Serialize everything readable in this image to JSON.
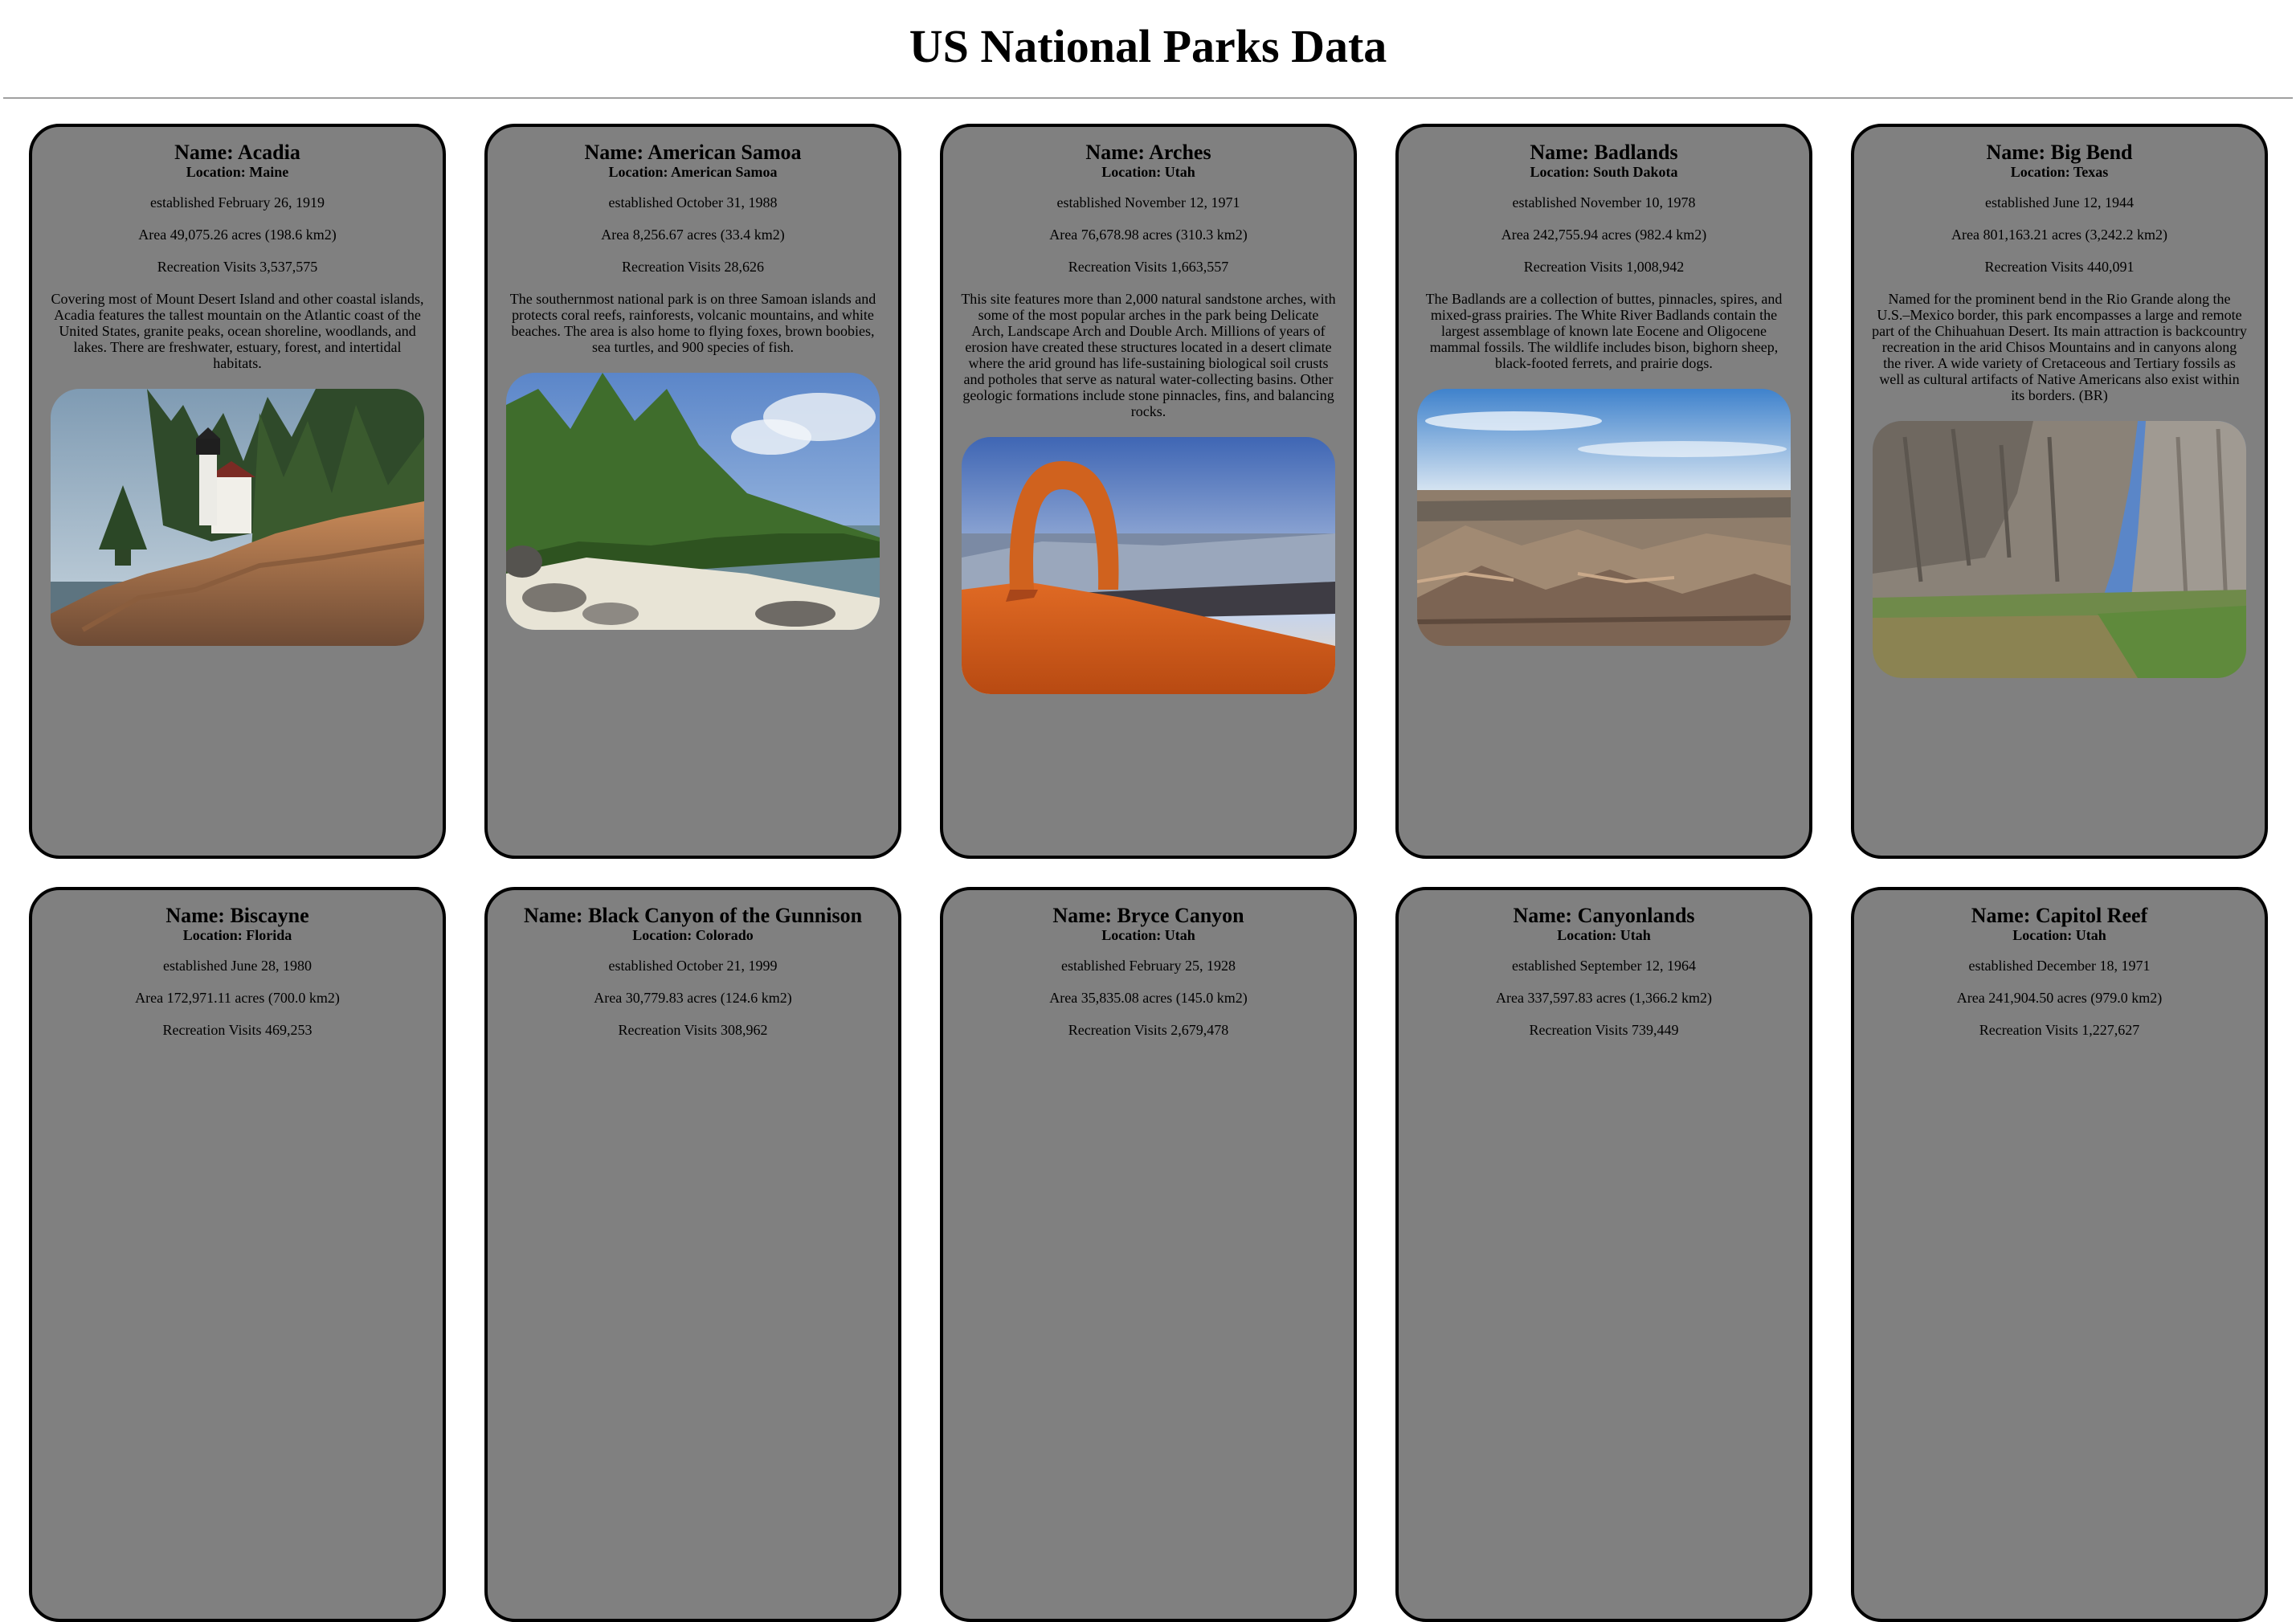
{
  "page": {
    "title": "US National Parks Data"
  },
  "parks": [
    {
      "name": "Name: Acadia",
      "location": "Location: Maine",
      "established": "established February 26, 1919",
      "area": "Area 49,075.26 acres (198.6 km2)",
      "visits": "Recreation Visits 3,537,575",
      "description": "Covering most of Mount Desert Island and other coastal islands, Acadia features the tallest mountain on the Atlantic coast of the United States, granite peaks, ocean shoreline, woodlands, and lakes. There are freshwater, estuary, forest, and intertidal habitats."
    },
    {
      "name": "Name: American Samoa",
      "location": "Location: American Samoa",
      "established": "established October 31, 1988",
      "area": "Area 8,256.67 acres (33.4 km2)",
      "visits": "Recreation Visits 28,626",
      "description": "The southernmost national park is on three Samoan islands and protects coral reefs, rainforests, volcanic mountains, and white beaches. The area is also home to flying foxes, brown boobies, sea turtles, and 900 species of fish."
    },
    {
      "name": "Name: Arches",
      "location": "Location: Utah",
      "established": "established November 12, 1971",
      "area": "Area 76,678.98 acres (310.3 km2)",
      "visits": "Recreation Visits 1,663,557",
      "description": "This site features more than 2,000 natural sandstone arches, with some of the most popular arches in the park being Delicate Arch, Landscape Arch and Double Arch. Millions of years of erosion have created these structures located in a desert climate where the arid ground has life-sustaining biological soil crusts and potholes that serve as natural water-collecting basins. Other geologic formations include stone pinnacles, fins, and balancing rocks."
    },
    {
      "name": "Name: Badlands",
      "location": "Location: South Dakota",
      "established": "established November 10, 1978",
      "area": "Area 242,755.94 acres (982.4 km2)",
      "visits": "Recreation Visits 1,008,942",
      "description": "The Badlands are a collection of buttes, pinnacles, spires, and mixed-grass prairies. The White River Badlands contain the largest assemblage of known late Eocene and Oligocene mammal fossils. The wildlife includes bison, bighorn sheep, black-footed ferrets, and prairie dogs."
    },
    {
      "name": "Name: Big Bend",
      "location": "Location: Texas",
      "established": "established June 12, 1944",
      "area": "Area 801,163.21 acres (3,242.2 km2)",
      "visits": "Recreation Visits 440,091",
      "description": "Named for the prominent bend in the Rio Grande along the U.S.–Mexico border, this park encompasses a large and remote part of the Chihuahuan Desert. Its main attraction is backcountry recreation in the arid Chisos Mountains and in canyons along the river. A wide variety of Cretaceous and Tertiary fossils as well as cultural artifacts of Native Americans also exist within its borders. (BR)"
    },
    {
      "name": "Name: Biscayne",
      "location": "Location: Florida",
      "established": "established June 28, 1980",
      "area": "Area 172,971.11 acres (700.0 km2)",
      "visits": "Recreation Visits 469,253",
      "description": ""
    },
    {
      "name": "Name: Black Canyon of the Gunnison",
      "location": "Location: Colorado",
      "established": "established October 21, 1999",
      "area": "Area 30,779.83 acres (124.6 km2)",
      "visits": "Recreation Visits 308,962",
      "description": ""
    },
    {
      "name": "Name: Bryce Canyon",
      "location": "Location: Utah",
      "established": "established February 25, 1928",
      "area": "Area 35,835.08 acres (145.0 km2)",
      "visits": "Recreation Visits 2,679,478",
      "description": ""
    },
    {
      "name": "Name: Canyonlands",
      "location": "Location: Utah",
      "established": "established September 12, 1964",
      "area": "Area 337,597.83 acres (1,366.2 km2)",
      "visits": "Recreation Visits 739,449",
      "description": ""
    },
    {
      "name": "Name: Capitol Reef",
      "location": "Location: Utah",
      "established": "established December 18, 1971",
      "area": "Area 241,904.50 acres (979.0 km2)",
      "visits": "Recreation Visits 1,227,627",
      "description": ""
    }
  ]
}
